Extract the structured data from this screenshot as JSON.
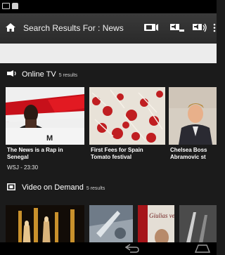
{
  "action_bar": {
    "title": "Search Results For : News",
    "icons": [
      "home-icon",
      "cast-icon",
      "volume-down-icon",
      "volume-up-icon",
      "overflow-menu-icon"
    ]
  },
  "online_tv": {
    "label": "Online TV",
    "count": "5 results",
    "icon": "broadcast-icon",
    "items": [
      {
        "line1": "The News is a Rap in",
        "line2": "Senegal",
        "meta": "WSJ - 23:30"
      },
      {
        "line1": "First Fees for Spain",
        "line2": "Tomato festival"
      },
      {
        "line1": "Chelsea Boss",
        "line2": "Abramovic st"
      }
    ]
  },
  "video_on_demand": {
    "label": "Video on Demand",
    "count": "5 results",
    "icon": "film-icon",
    "items": [
      {
        "thumb_text": ""
      },
      {
        "thumb_text": ""
      },
      {
        "thumb_text": "Giulias verschwinden"
      },
      {
        "thumb_text": ""
      }
    ]
  },
  "nav": {
    "icons": [
      "back-icon",
      "home-nav-icon"
    ]
  }
}
